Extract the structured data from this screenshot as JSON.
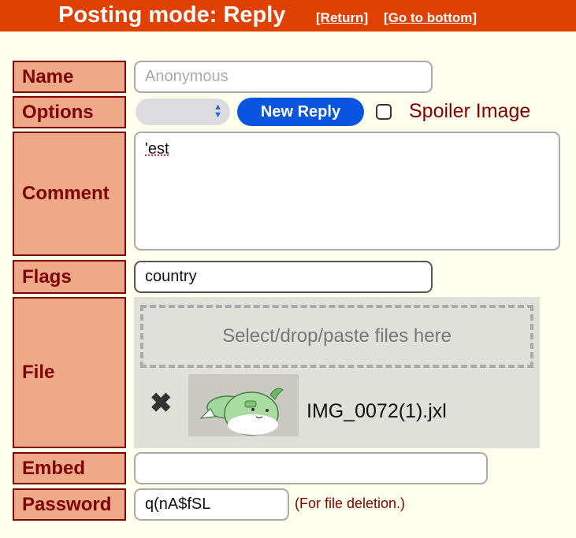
{
  "header": {
    "title": "Posting mode: Reply",
    "return_link": "[Return]",
    "bottom_link": "[Go to bottom]"
  },
  "form": {
    "name": {
      "label": "Name",
      "placeholder": "Anonymous",
      "value": ""
    },
    "options": {
      "label": "Options",
      "selected": "",
      "submit_label": "New Reply",
      "spoiler_label": "Spoiler Image",
      "spoiler_checked": false
    },
    "comment": {
      "label": "Comment",
      "value": "'est"
    },
    "flags": {
      "label": "Flags",
      "value": "country"
    },
    "file": {
      "label": "File",
      "drop_text": "Select/drop/paste files here",
      "attached_name": "IMG_0072(1).jxl"
    },
    "embed": {
      "label": "Embed",
      "value": ""
    },
    "password": {
      "label": "Password",
      "value": "q(nA$fSL",
      "note": "(For file deletion.)"
    }
  },
  "colors": {
    "banner": "#e04000",
    "label_bg": "#eeaa88",
    "label_text": "#800000",
    "page_bg": "#ffffee",
    "button_blue": "#0a55e0"
  }
}
